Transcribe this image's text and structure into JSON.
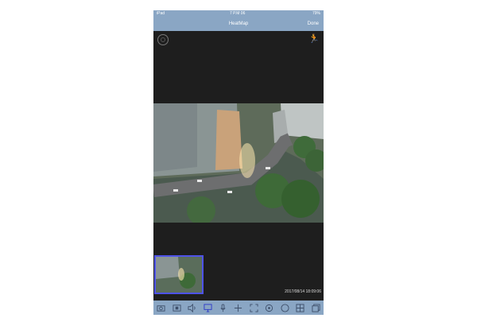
{
  "status_bar": {
    "carrier": "iPad ",
    "time": "7 P.M 06",
    "battery": "79%"
  },
  "nav": {
    "title": "HeatMap",
    "done_label": "Done"
  },
  "viewer": {
    "timestamp": "2017/08/14 18:09:06"
  },
  "toolbar": {
    "items": [
      {
        "icon": "snapshot-icon"
      },
      {
        "icon": "record-icon"
      },
      {
        "icon": "speaker-icon"
      },
      {
        "icon": "heatmap-icon",
        "active": true
      },
      {
        "icon": "microphone-icon"
      },
      {
        "icon": "ptz-icon"
      },
      {
        "icon": "fullscreen-icon"
      },
      {
        "icon": "preset-icon"
      },
      {
        "icon": "zoom-icon"
      },
      {
        "icon": "layout-icon"
      },
      {
        "icon": "stream-icon"
      }
    ]
  },
  "colors": {
    "bar": "#8aa6c4",
    "accent": "#4e52e8",
    "background": "#1e1e1e"
  }
}
